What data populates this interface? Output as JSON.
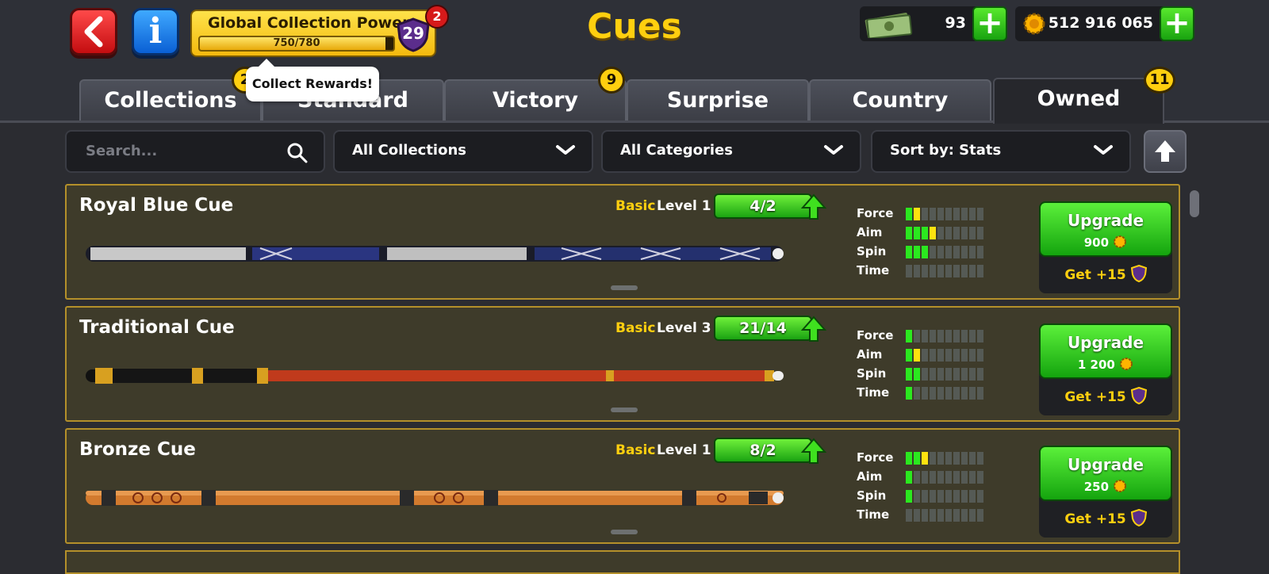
{
  "header": {
    "title": "Cues",
    "global_power": {
      "title": "Global Collection Power",
      "progress_text": "750/780",
      "progress": 0.96,
      "level": "29",
      "badge": "2"
    },
    "cash": {
      "value": "93"
    },
    "coins": {
      "value": "512 916 065"
    }
  },
  "tooltip": "Collect Rewards!",
  "tabs": [
    {
      "label": "Collections",
      "badge": "2"
    },
    {
      "label": "Standard",
      "badge": ""
    },
    {
      "label": "Victory",
      "badge": "9"
    },
    {
      "label": "Surprise",
      "badge": ""
    },
    {
      "label": "Country",
      "badge": ""
    },
    {
      "label": "Owned",
      "badge": "11",
      "active": true
    }
  ],
  "filters": {
    "search_placeholder": "Search...",
    "collections": "All Collections",
    "categories": "All Categories",
    "sort": "Sort by: Stats"
  },
  "cues": [
    {
      "name": "Royal Blue Cue",
      "rarity": "Basic",
      "level": "Level 1",
      "progress": "4/2",
      "stats": {
        "Force": 2,
        "Aim": 4,
        "Spin": 3,
        "Time": 0
      },
      "upgrade": {
        "label": "Upgrade",
        "cost": "900"
      },
      "get_plus": "Get +15"
    },
    {
      "name": "Traditional Cue",
      "rarity": "Basic",
      "level": "Level 3",
      "progress": "21/14",
      "stats": {
        "Force": 1,
        "Aim": 2,
        "Spin": 2,
        "Time": 1
      },
      "upgrade": {
        "label": "Upgrade",
        "cost": "1 200"
      },
      "get_plus": "Get +15"
    },
    {
      "name": "Bronze Cue",
      "rarity": "Basic",
      "level": "Level 1",
      "progress": "8/2",
      "stats": {
        "Force": 3,
        "Aim": 1,
        "Spin": 1,
        "Time": 0
      },
      "upgrade": {
        "label": "Upgrade",
        "cost": "250"
      },
      "get_plus": "Get +15"
    }
  ],
  "stat_labels": [
    "Force",
    "Aim",
    "Spin",
    "Time"
  ],
  "colors": {
    "gold": "#ffcf0f",
    "green": "#2be81f",
    "yellow": "#ffe20f",
    "card_bg": "#3e3b2a",
    "card_border": "#b4902a"
  }
}
